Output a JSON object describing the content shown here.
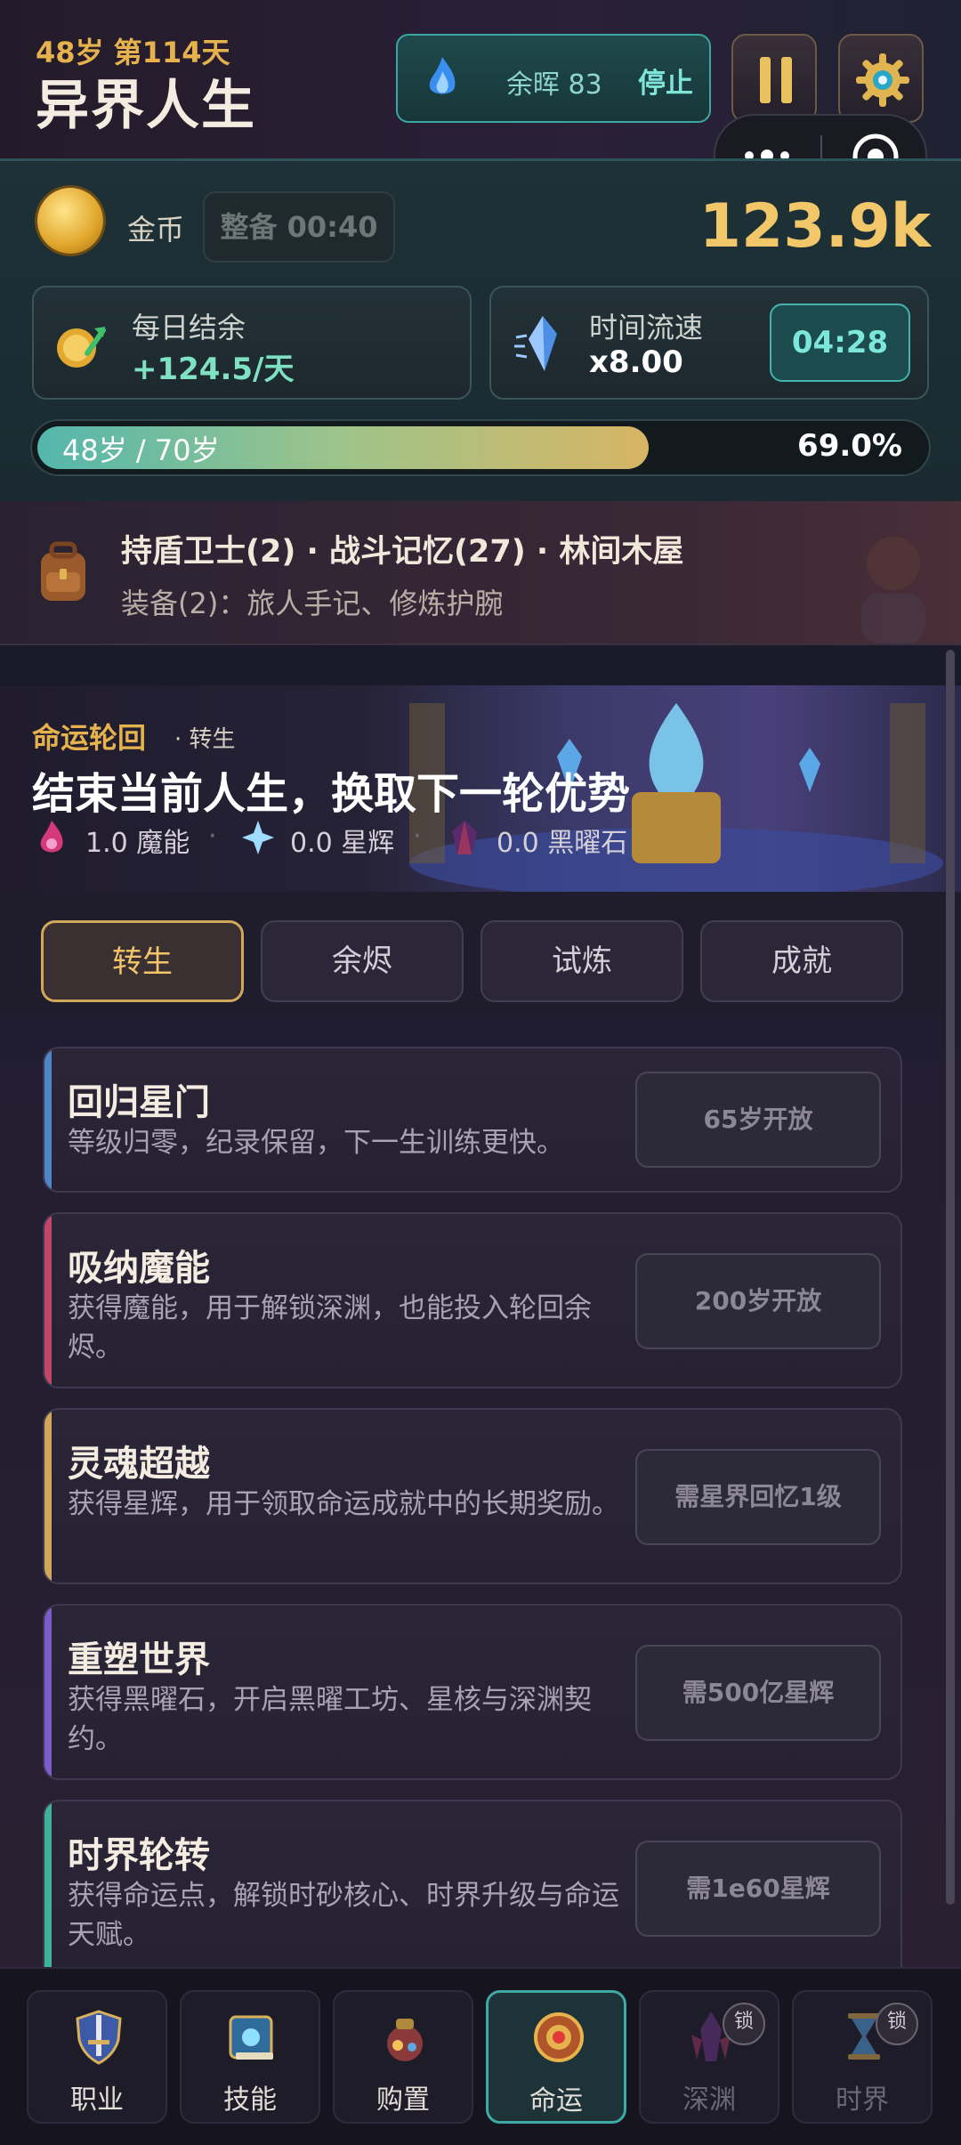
{
  "header": {
    "age_day": "48岁 第114天",
    "title": "异界人生",
    "ember_label": "余晖 83",
    "ember_stop": "停止"
  },
  "stats": {
    "coin_label": "金币",
    "prep_timer": "整备 00:40",
    "coin_value": "123.9k",
    "daily_title": "每日结余",
    "daily_value": "+124.5/天",
    "speed_title": "时间流速",
    "speed_value": "x8.00",
    "speed_timer": "04:28",
    "life_label": "48岁 / 70岁",
    "life_progress": 0.69,
    "life_pct": "69.0%"
  },
  "info": {
    "line1": "持盾卫士(2) · 战斗记忆(27) · 林间木屋",
    "line2": "装备(2)：旅人手记、修炼护腕"
  },
  "banner": {
    "kicker": "命运轮回",
    "sub": "· 转生",
    "title": "结束当前人生，换取下一轮优势",
    "res1": "1.0 魔能",
    "res2": "0.0 星辉",
    "res3": "0.0 黑曜石"
  },
  "tabs": [
    "转生",
    "余烬",
    "试炼",
    "成就"
  ],
  "cards": [
    {
      "title": "回归星门",
      "desc": "等级归零，纪录保留，下一生训练更快。",
      "button": "65岁开放",
      "accent": "#4f86c8"
    },
    {
      "title": "吸纳魔能",
      "desc": "获得魔能，用于解锁深渊，也能投入轮回余烬。",
      "button": "200岁开放",
      "accent": "#c2456a"
    },
    {
      "title": "灵魂超越",
      "desc": "获得星辉，用于领取命运成就中的长期奖励。",
      "button": "需星界回忆1级",
      "accent": "#d1a85a"
    },
    {
      "title": "重塑世界",
      "desc": "获得黑曜石，开启黑曜工坊、星核与深渊契约。",
      "button": "需500亿星辉",
      "accent": "#7b5cc8"
    },
    {
      "title": "时界轮转",
      "desc": "获得命运点，解锁时砂核心、时界升级与命运天赋。",
      "button": "需1e60星辉",
      "accent": "#3fb39a"
    }
  ],
  "nav": [
    {
      "label": "职业",
      "icon": "shield-sword-icon"
    },
    {
      "label": "技能",
      "icon": "spellbook-icon"
    },
    {
      "label": "购置",
      "icon": "treasure-bag-icon"
    },
    {
      "label": "命运",
      "icon": "fate-gem-icon"
    },
    {
      "label": "深渊",
      "icon": "abyss-crystal-icon"
    },
    {
      "label": "时界",
      "icon": "hourglass-icon"
    }
  ],
  "lock_text": "锁"
}
